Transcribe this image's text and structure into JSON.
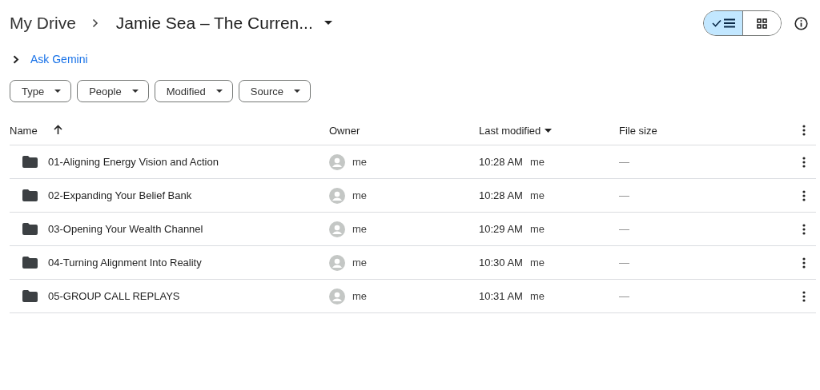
{
  "breadcrumb": [
    {
      "label": "My Drive"
    },
    {
      "label": "Jamie Sea – The Curren..."
    }
  ],
  "view_toggle": [
    {
      "kind": "list",
      "selected": true
    },
    {
      "kind": "grid",
      "selected": false
    }
  ],
  "gemini": {
    "label": "Ask Gemini"
  },
  "filters": [
    {
      "label": "Type"
    },
    {
      "label": "People"
    },
    {
      "label": "Modified"
    },
    {
      "label": "Source"
    }
  ],
  "table": {
    "columns": [
      {
        "label": "Name",
        "sorted": true
      },
      {
        "label": "Owner"
      },
      {
        "label": "Last modified",
        "dropdown": true
      },
      {
        "label": "File size"
      }
    ],
    "rows": [
      {
        "name": "01-Aligning Energy Vision and Action",
        "owner": "me",
        "modified": "10:28 AM",
        "modified_by": "me",
        "size": "—"
      },
      {
        "name": "02-Expanding Your Belief Bank",
        "owner": "me",
        "modified": "10:28 AM",
        "modified_by": "me",
        "size": "—"
      },
      {
        "name": "03-Opening Your Wealth Channel",
        "owner": "me",
        "modified": "10:29 AM",
        "modified_by": "me",
        "size": "—"
      },
      {
        "name": "04-Turning Alignment Into Reality",
        "owner": "me",
        "modified": "10:30 AM",
        "modified_by": "me",
        "size": "—"
      },
      {
        "name": "05-GROUP CALL REPLAYS",
        "owner": "me",
        "modified": "10:31 AM",
        "modified_by": "me",
        "size": "—"
      }
    ]
  }
}
